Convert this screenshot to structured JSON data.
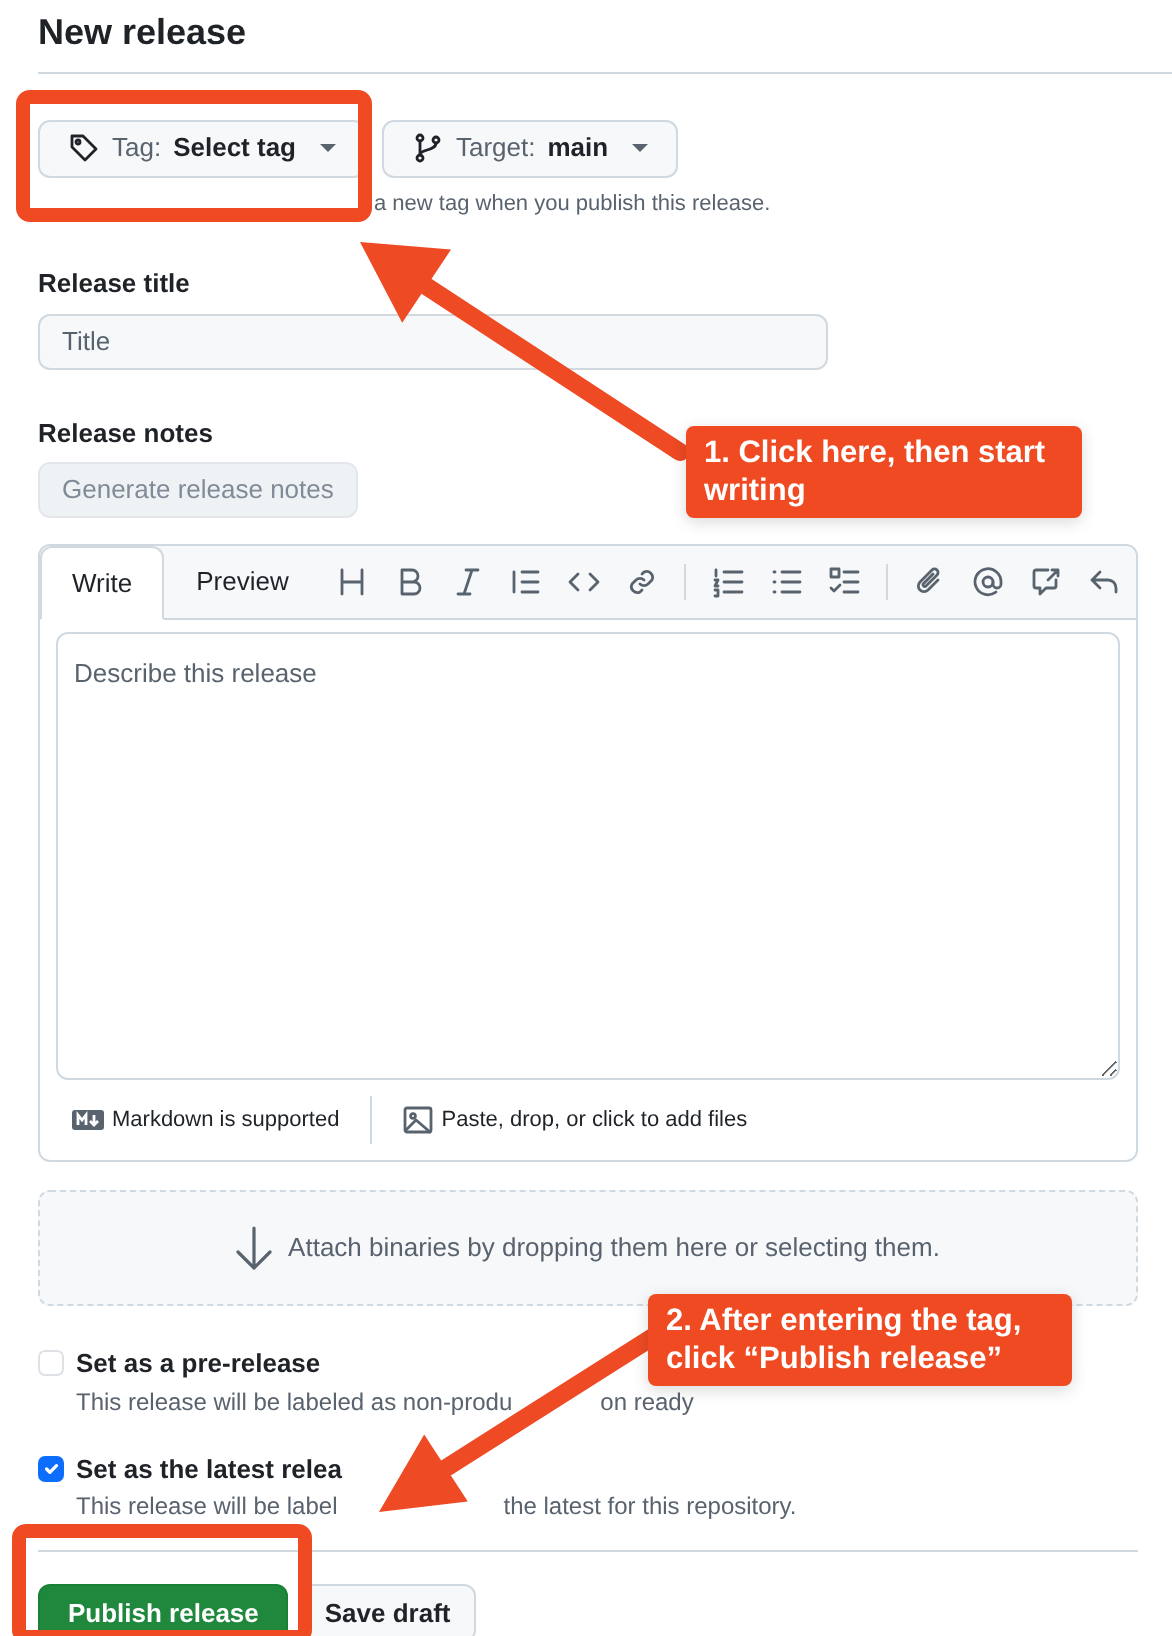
{
  "page": {
    "title": "New release"
  },
  "tag_picker": {
    "label": "Tag:",
    "value": "Select tag"
  },
  "target_picker": {
    "label": "Target:",
    "value": "main"
  },
  "tag_hint": "a new tag when you publish this release.",
  "release_title": {
    "label": "Release title",
    "placeholder": "Title"
  },
  "release_notes": {
    "label": "Release notes",
    "generate_button": {
      "label": "Generate release notes",
      "disabled": true
    },
    "tabs": [
      {
        "label": "Write",
        "selected": true
      },
      {
        "label": "Preview",
        "selected": false
      }
    ],
    "placeholder": "Describe this release",
    "markdown_note": "Markdown is supported",
    "attach_note": "Paste, drop, or click to add files"
  },
  "dropzone": "Attach binaries by dropping them here or selecting them.",
  "options": [
    {
      "title_parts": [
        "Set as a pre-release"
      ],
      "description_parts": [
        "This release will be labeled as non-produ",
        "on ready"
      ],
      "checked": false
    },
    {
      "title_parts": [
        "Set as the latest relea"
      ],
      "description_parts": [
        "This release will be label",
        "the latest for this repository."
      ],
      "checked": true
    }
  ],
  "buttons": [
    {
      "label": "Publish release",
      "kind": "primary"
    },
    {
      "label": "Save draft",
      "kind": "secondary"
    }
  ],
  "annotations": [
    {
      "text": "1. Click here, then start writing"
    },
    {
      "text": "2. After entering the tag, click “Publish release”"
    }
  ]
}
